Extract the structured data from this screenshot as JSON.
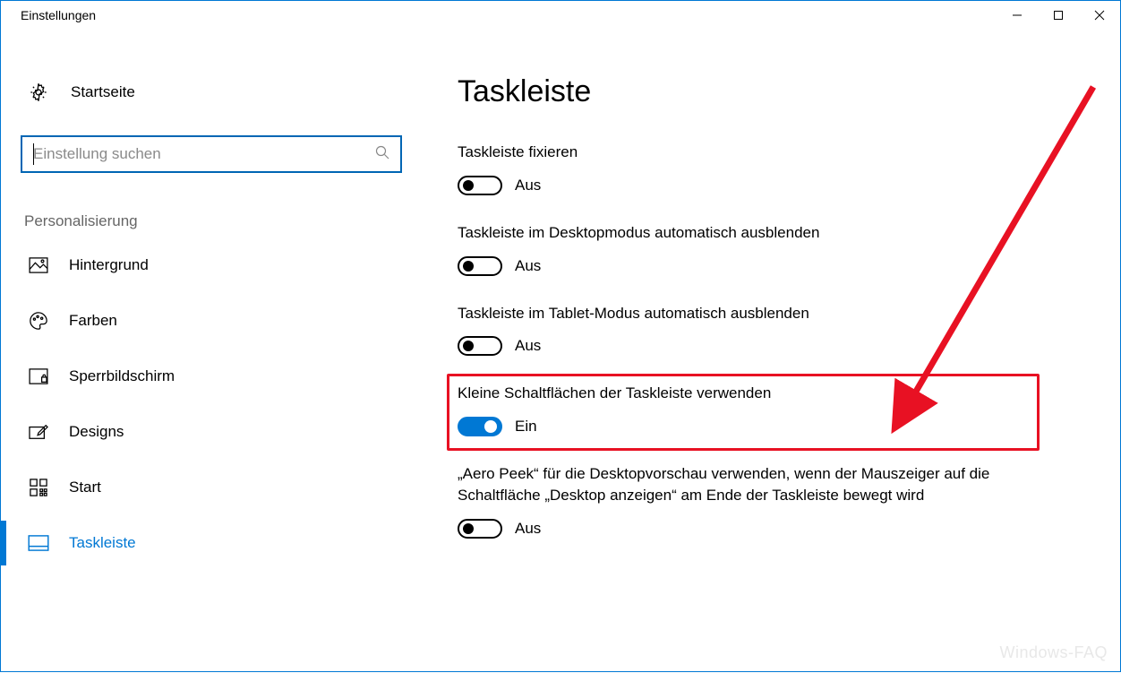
{
  "window": {
    "title": "Einstellungen"
  },
  "sidebar": {
    "home_label": "Startseite",
    "search_placeholder": "Einstellung suchen",
    "section_label": "Personalisierung",
    "items": [
      {
        "label": "Hintergrund"
      },
      {
        "label": "Farben"
      },
      {
        "label": "Sperrbildschirm"
      },
      {
        "label": "Designs"
      },
      {
        "label": "Start"
      },
      {
        "label": "Taskleiste",
        "active": true
      }
    ]
  },
  "main": {
    "title": "Taskleiste",
    "settings": [
      {
        "label": "Taskleiste fixieren",
        "state": "Aus",
        "on": false
      },
      {
        "label": "Taskleiste im Desktopmodus automatisch ausblenden",
        "state": "Aus",
        "on": false
      },
      {
        "label": "Taskleiste im Tablet-Modus automatisch ausblenden",
        "state": "Aus",
        "on": false
      },
      {
        "label": "Kleine Schaltflächen der Taskleiste verwenden",
        "state": "Ein",
        "on": true,
        "highlighted": true
      },
      {
        "label": "„Aero Peek“ für die Desktopvorschau verwenden, wenn der Mauszeiger auf die Schaltfläche „Desktop anzeigen“ am Ende der Taskleiste bewegt wird",
        "state": "Aus",
        "on": false
      }
    ]
  },
  "annotation": {
    "arrow_color": "#e81123",
    "highlight_color": "#e81123"
  },
  "watermark": "Windows-FAQ"
}
